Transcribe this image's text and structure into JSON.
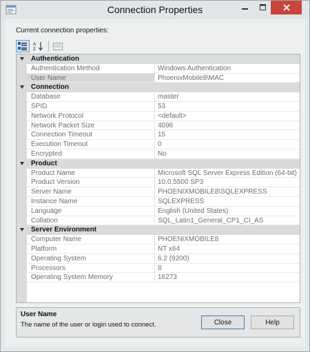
{
  "window": {
    "title": "Connection Properties"
  },
  "subtitle": "Current connection properties:",
  "toolbar": {
    "categorized_icon": "categorized-icon",
    "alphabetical_icon": "sort-az-icon",
    "property_pages_icon": "property-pages-icon"
  },
  "categories": [
    {
      "name": "Authentication",
      "rows": [
        {
          "name": "Authentication Method",
          "value": "Windows Authentication"
        },
        {
          "name": "User Name",
          "value": "PhoenixMobile8\\MAC"
        }
      ]
    },
    {
      "name": "Connection",
      "rows": [
        {
          "name": "Database",
          "value": "master"
        },
        {
          "name": "SPID",
          "value": "53"
        },
        {
          "name": "Network Protocol",
          "value": "<default>"
        },
        {
          "name": "Network Packet Size",
          "value": "4096"
        },
        {
          "name": "Connection Timeout",
          "value": "15"
        },
        {
          "name": "Execution Timeout",
          "value": "0"
        },
        {
          "name": "Encrypted",
          "value": "No"
        }
      ]
    },
    {
      "name": "Product",
      "rows": [
        {
          "name": "Product Name",
          "value": "Microsoft SQL Server Express Edition (64-bit)"
        },
        {
          "name": "Product Version",
          "value": "10.0.5500 SP3"
        },
        {
          "name": "Server Name",
          "value": "PHOENIXMOBILE8\\SQLEXPRESS"
        },
        {
          "name": "Instance Name",
          "value": "SQLEXPRESS"
        },
        {
          "name": "Language",
          "value": "English (United States)"
        },
        {
          "name": "Collation",
          "value": "SQL_Latin1_General_CP1_CI_AS"
        }
      ]
    },
    {
      "name": "Server Environment",
      "rows": [
        {
          "name": "Computer Name",
          "value": "PHOENIXMOBILE8"
        },
        {
          "name": "Platform",
          "value": "NT x64"
        },
        {
          "name": "Operating System",
          "value": "6.2 (9200)"
        },
        {
          "name": "Processors",
          "value": "8"
        },
        {
          "name": "Operating System Memory",
          "value": "16273"
        }
      ]
    }
  ],
  "description": {
    "title": "User Name",
    "text": "The name of the user or login used to connect."
  },
  "buttons": {
    "close": "Close",
    "help": "Help"
  },
  "colors": {
    "close_button_bg": "#c7453d",
    "selected_toolbar_bg": "#cfe3f7"
  }
}
